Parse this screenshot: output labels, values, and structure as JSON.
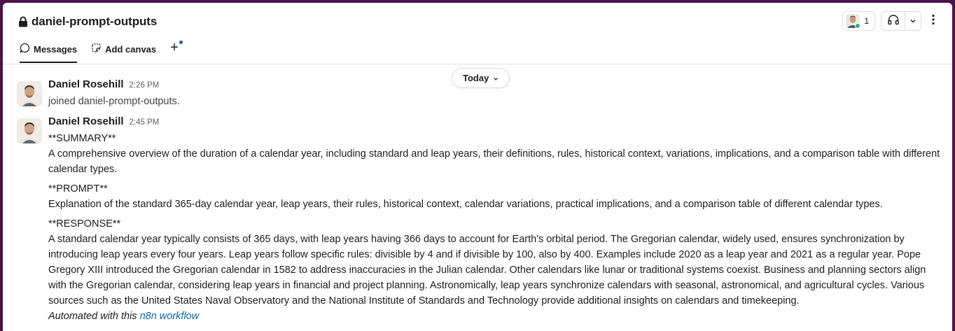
{
  "channel": {
    "name": "daniel-prompt-outputs",
    "member_count": "1"
  },
  "tabs": [
    {
      "label": "Messages",
      "icon": "message-icon"
    },
    {
      "label": "Add canvas",
      "icon": "canvas-icon"
    },
    {
      "label": "+",
      "icon": "plus-icon"
    }
  ],
  "date_divider": {
    "label": "Today"
  },
  "messages": [
    {
      "sender": "Daniel Rosehill",
      "time": "2:26 PM",
      "text": "joined daniel-prompt-outputs."
    },
    {
      "sender": "Daniel Rosehill",
      "time": "2:45 PM",
      "summary_heading": "**SUMMARY**",
      "summary_text": "A comprehensive overview of the duration of a calendar year, including standard and leap years, their definitions, rules, historical context, variations, implications, and a comparison table with different calendar types.",
      "prompt_heading": "**PROMPT**",
      "prompt_text": "Explanation of the standard 365-day calendar year, leap years, their rules, historical context, calendar variations, practical implications, and a comparison table of different calendar types.",
      "response_heading": "**RESPONSE**",
      "response_text": "A standard calendar year typically consists of 365 days, with leap years having 366 days to account for Earth's orbital period. The Gregorian calendar, widely used, ensures synchronization by introducing leap years every four years. Leap years follow specific rules: divisible by 4 and if divisible by 100, also by 400. Examples include 2020 as a leap year and 2021 as a regular year. Pope Gregory XIII introduced the Gregorian calendar in 1582 to address inaccuracies in the Julian calendar. Other calendars like lunar or traditional systems coexist. Business and planning sectors align with the Gregorian calendar, considering leap years in financial and project planning. Astronomically, leap years synchronize calendars with seasonal, astronomical, and agricultural cycles. Various sources such as the United States Naval Observatory and the National Institute of Standards and Technology provide additional insights on calendars and timekeeping.",
      "footer_prefix": "Automated with this",
      "footer_link": "n8n workflow"
    }
  ],
  "colors": {
    "window_frame": "#4a154b",
    "link": "#1264a3",
    "presence": "#2bac76"
  }
}
